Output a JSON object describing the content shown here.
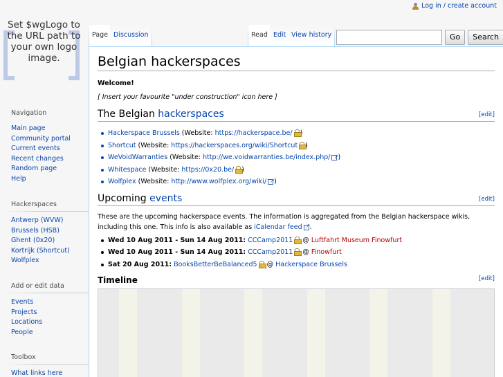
{
  "personal": {
    "login": "Log in / create account"
  },
  "logo": {
    "text": "Set $wgLogo to the URL path to your own logo image."
  },
  "sidebar": {
    "navigation": {
      "title": "Navigation",
      "items": [
        "Main page",
        "Community portal",
        "Current events",
        "Recent changes",
        "Random page",
        "Help"
      ]
    },
    "hackerspaces": {
      "title": "Hackerspaces",
      "items": [
        "Antwerp (WVW)",
        "Brussels (HSB)",
        "Ghent (0x20)",
        "Kortrijk (Shortcut)",
        "Wolfplex"
      ]
    },
    "addedit": {
      "title": "Add or edit data",
      "items": [
        "Events",
        "Projects",
        "Locations",
        "People"
      ]
    },
    "toolbox": {
      "title": "Toolbox",
      "items": [
        "What links here"
      ]
    }
  },
  "tabs": {
    "page": "Page",
    "discussion": "Discussion",
    "read": "Read",
    "edit": "Edit",
    "history": "View history"
  },
  "search": {
    "go": "Go",
    "search": "Search",
    "value": ""
  },
  "content": {
    "title": "Belgian hackerspaces",
    "welcome": "Welcome!",
    "insert": "[ Insert your favourite \"under construction\" icon here ]",
    "section1": {
      "prefix": "The Belgian ",
      "link": "hackerspaces",
      "edit": "[edit]"
    },
    "spaces": [
      {
        "name": "Hackerspace Brussels",
        "pre": " (Website: ",
        "url": "https://hackerspace.be/",
        "post": ")"
      },
      {
        "name": "Shortcut",
        "pre": " (Website: ",
        "url": "https://hackerspaces.org/wiki/Shortcut",
        "post": ")"
      },
      {
        "name": "WeVoidWarranties",
        "pre": " (Website: ",
        "url": "http://we.voidwarranties.be/index.php/",
        "post": ")"
      },
      {
        "name": "Whitespace",
        "pre": " (Website: ",
        "url": "https://0x20.be/",
        "post": ")"
      },
      {
        "name": "Wolfplex",
        "pre": " (Website: ",
        "url": "http://www.wolfplex.org/wiki/",
        "post": ")"
      }
    ],
    "section2": {
      "prefix": "Upcoming ",
      "link": "events",
      "edit": "[edit]"
    },
    "intro": "These are the upcoming hackerspace events. The information is aggregated from the Belgian hackerspace wikis, including this one. This info is also available as ",
    "ical": "iCalendar feed",
    "intro_end": ".",
    "events": [
      {
        "date": "Wed 10 Aug 2011 - Sun 14 Aug 2011:",
        "name": "CCCamp2011",
        "at": " @ ",
        "place": "Luftfahrt Museum Finowfurt"
      },
      {
        "date": "Wed 10 Aug 2011 - Sun 14 Aug 2011:",
        "name": "CCCamp2011",
        "at": " @ ",
        "place": "Finowfurt"
      },
      {
        "date": "Sat 20 Aug 2011:",
        "name": "BooksBetterBeBalanced5",
        "at": " @ ",
        "place": "Hackerspace Brussels"
      }
    ],
    "timeline": {
      "title": "Timeline",
      "edit": "[edit]"
    }
  },
  "colors": {
    "link": "#0645ad",
    "redlink": "#ba0000",
    "border": "#a7d7f9"
  }
}
